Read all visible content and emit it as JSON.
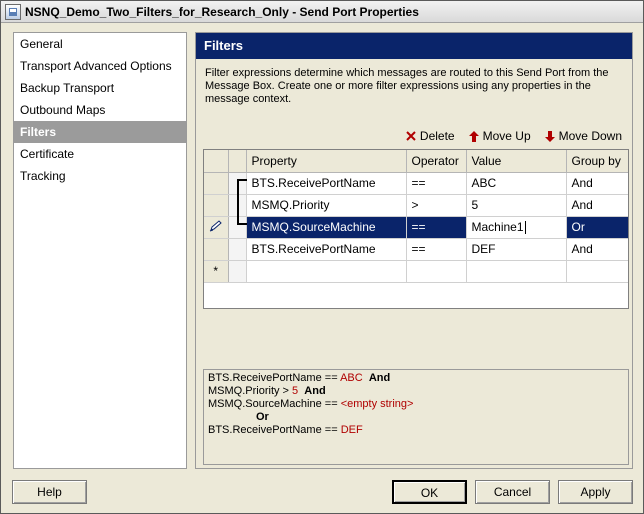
{
  "window": {
    "title": "NSNQ_Demo_Two_Filters_for_Research_Only - Send Port Properties"
  },
  "sidebar": {
    "items": [
      {
        "label": "General"
      },
      {
        "label": "Transport Advanced Options"
      },
      {
        "label": "Backup Transport"
      },
      {
        "label": "Outbound Maps"
      },
      {
        "label": "Filters",
        "selected": true
      },
      {
        "label": "Certificate"
      },
      {
        "label": "Tracking"
      }
    ]
  },
  "panel": {
    "header": "Filters",
    "description": "Filter expressions determine which messages are routed to this Send Port from the Message Box. Create one or more filter expressions using any properties in the message context."
  },
  "toolbar": {
    "delete_label": "Delete",
    "move_up_label": "Move Up",
    "move_down_label": "Move Down"
  },
  "grid": {
    "columns": [
      "Property",
      "Operator",
      "Value",
      "Group by"
    ],
    "rows": [
      {
        "property": "BTS.ReceivePortName",
        "operator": "==",
        "value": "ABC",
        "group_by": "And"
      },
      {
        "property": "MSMQ.Priority",
        "operator": ">",
        "value": "5",
        "group_by": "And"
      },
      {
        "property": "MSMQ.SourceMachine",
        "operator": "==",
        "value": "Machine1",
        "group_by": "Or"
      },
      {
        "property": "BTS.ReceivePortName",
        "operator": "==",
        "value": "DEF",
        "group_by": "And"
      }
    ],
    "new_row_marker": "*"
  },
  "expression": {
    "line1": {
      "prop": "BTS.ReceivePortName",
      "op": " == ",
      "val": "ABC",
      "join": "And"
    },
    "line2": {
      "prop": "MSMQ.Priority",
      "op": " > ",
      "val": "5",
      "join": "And"
    },
    "line3": {
      "prop": "MSMQ.SourceMachine",
      "op": " == ",
      "val": "<empty string>"
    },
    "line4": {
      "join": "Or"
    },
    "line5": {
      "prop": "BTS.ReceivePortName",
      "op": " == ",
      "val": "DEF"
    }
  },
  "buttons": {
    "help": "Help",
    "ok": "OK",
    "cancel": "Cancel",
    "apply": "Apply"
  },
  "colors": {
    "header_bg": "#0a246a",
    "selection": "#0a246a",
    "value_red": "#b00000"
  }
}
